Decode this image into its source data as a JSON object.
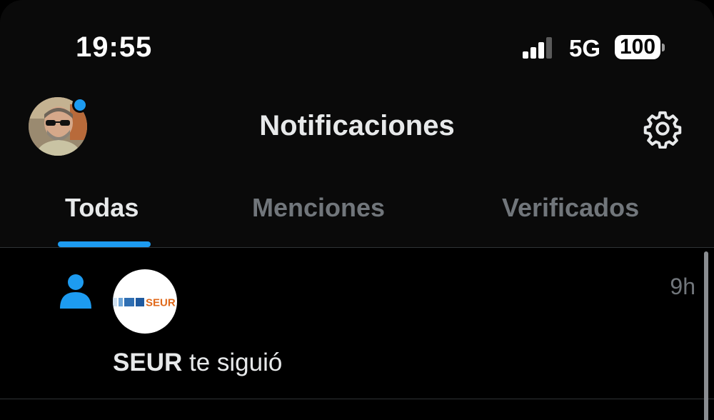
{
  "status_bar": {
    "time": "19:55",
    "network": "5G",
    "battery": "100"
  },
  "header": {
    "title": "Notificaciones",
    "avatar_icon": "user-avatar",
    "settings_icon": "gear-icon"
  },
  "tabs": [
    {
      "label": "Todas",
      "active": true
    },
    {
      "label": "Menciones",
      "active": false
    },
    {
      "label": "Verificados",
      "active": false
    }
  ],
  "notifications": [
    {
      "type_icon": "follow-person-icon",
      "logo_text": "SEUR",
      "time": "9h",
      "actor": "SEUR",
      "message": "te siguió"
    }
  ],
  "colors": {
    "accent": "#1d9bf0",
    "background": "#000000",
    "muted_text": "#71767b",
    "brand_seur": "#e06a1b"
  }
}
